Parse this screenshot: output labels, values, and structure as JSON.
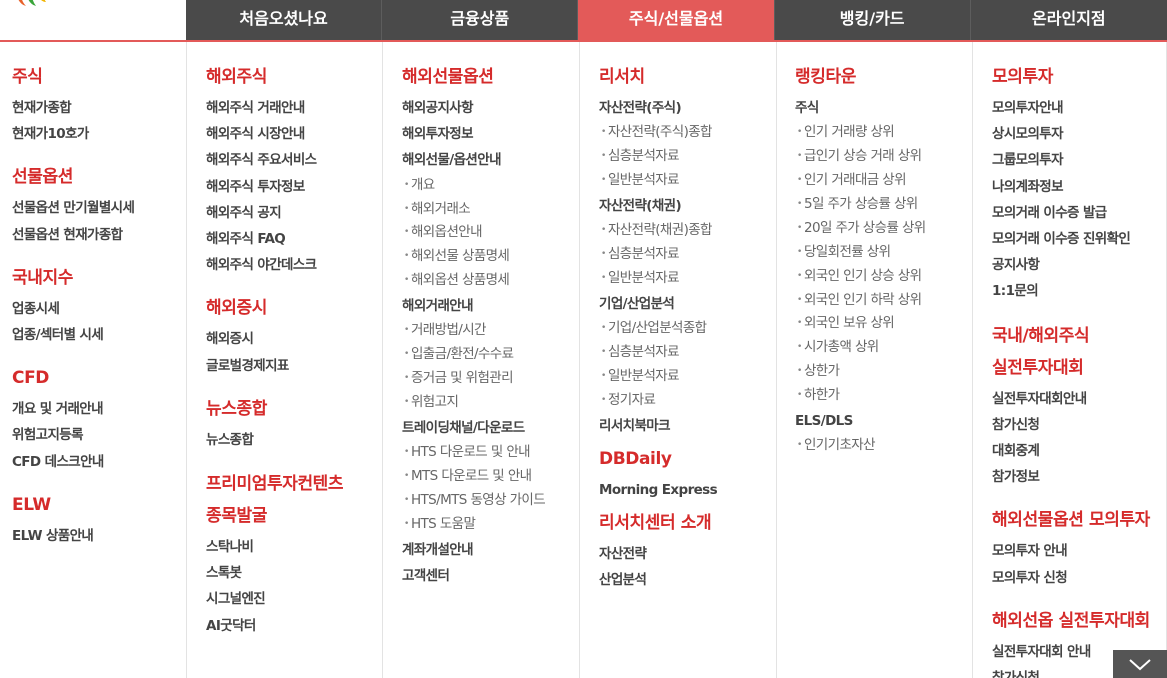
{
  "nav": {
    "items": [
      "처음오셨나요",
      "금융상품",
      "주식/선물옵션",
      "뱅킹/카드",
      "온라인지점"
    ],
    "active_index": 2
  },
  "colors": {
    "accent": "#e35a59",
    "heading": "#d52b2b",
    "nav_bg": "#4a4a4a"
  },
  "col1": {
    "sections": [
      {
        "title": "주식",
        "links": [
          "현재가종합",
          "현재가10호가"
        ]
      },
      {
        "title": "선물옵션",
        "links": [
          "선물옵션 만기월별시세",
          "선물옵션 현재가종합"
        ]
      },
      {
        "title": "국내지수",
        "links": [
          "업종시세",
          "업종/섹터별 시세"
        ]
      },
      {
        "title": "CFD",
        "links": [
          "개요 및 거래안내",
          "위험고지등록",
          "CFD 데스크안내"
        ]
      },
      {
        "title": "ELW",
        "links": [
          "ELW 상품안내"
        ]
      }
    ]
  },
  "col2": {
    "sections": [
      {
        "title": "해외주식",
        "links": [
          "해외주식 거래안내",
          "해외주식 시장안내",
          "해외주식 주요서비스",
          "해외주식 투자정보",
          "해외주식 공지",
          "해외주식 FAQ",
          "해외주식 야간데스크"
        ]
      },
      {
        "title": "해외증시",
        "links": [
          "해외증시",
          "글로벌경제지표"
        ]
      },
      {
        "title": "뉴스종합",
        "links": [
          "뉴스종합"
        ]
      },
      {
        "title_line1": "프리미엄투자컨텐츠",
        "title_line2": "종목발굴",
        "links": [
          "스탁나비",
          "스톡봇",
          "시그널엔진",
          "AI굿닥터"
        ]
      }
    ]
  },
  "col3": {
    "title": "해외선물옵션",
    "groups": [
      {
        "label": "해외공지사항",
        "subs": []
      },
      {
        "label": "해외투자정보",
        "subs": []
      },
      {
        "label": "해외선물/옵션안내",
        "subs": [
          "개요",
          "해외거래소",
          "해외옵션안내",
          "해외선물 상품명세",
          "해외옵션 상품명세"
        ]
      },
      {
        "label": "해외거래안내",
        "subs": [
          "거래방법/시간",
          "입출금/환전/수수료",
          "증거금 및 위험관리",
          "위험고지"
        ]
      },
      {
        "label": "트레이딩채널/다운로드",
        "subs": [
          "HTS 다운로드 및 안내",
          "MTS 다운로드 및 안내",
          "HTS/MTS 동영상 가이드",
          "HTS 도움말"
        ]
      },
      {
        "label": "계좌개설안내",
        "subs": []
      },
      {
        "label": "고객센터",
        "subs": []
      }
    ]
  },
  "col4": {
    "sections": [
      {
        "title": "리서치",
        "groups": [
          {
            "label": "자산전략(주식)",
            "subs": [
              "자산전략(주식)종합",
              "심층분석자료",
              "일반분석자료"
            ]
          },
          {
            "label": "자산전략(채권)",
            "subs": [
              "자산전략(채권)종합",
              "심층분석자료",
              "일반분석자료"
            ]
          },
          {
            "label": "기업/산업분석",
            "subs": [
              "기업/산업분석종합",
              "심층분석자료",
              "일반분석자료",
              "정기자료"
            ]
          },
          {
            "label": "리서치북마크",
            "subs": []
          }
        ]
      },
      {
        "title": "DBDaily",
        "groups": [
          {
            "label": "Morning Express",
            "subs": []
          }
        ]
      },
      {
        "title": "리서치센터 소개",
        "groups": [
          {
            "label": "자산전략",
            "subs": []
          },
          {
            "label": "산업분석",
            "subs": []
          }
        ]
      }
    ]
  },
  "col5": {
    "title": "랭킹타운",
    "groups": [
      {
        "label": "주식",
        "subs": [
          "인기 거래량 상위",
          "급인기 상승 거래 상위",
          "인기 거래대금 상위",
          "5일 주가 상승률 상위",
          "20일 주가 상승률 상위",
          "당일회전률 상위",
          "외국인 인기 상승 상위",
          "외국인 인기 하락 상위",
          "외국인 보유 상위",
          "시가총액 상위",
          "상한가",
          "하한가"
        ]
      },
      {
        "label": "ELS/DLS",
        "subs": [
          "인기기초자산"
        ]
      }
    ]
  },
  "col6": {
    "sections": [
      {
        "title": "모의투자",
        "links": [
          "모의투자안내",
          "상시모의투자",
          "그룹모의투자",
          "나의계좌정보",
          "모의거래 이수증 발급",
          "모의거래 이수증 진위확인",
          "공지사항",
          "1:1문의"
        ]
      },
      {
        "title_line1": "국내/해외주식",
        "title_line2": "실전투자대회",
        "links": [
          "실전투자대회안내",
          "참가신청",
          "대회중계",
          "참가정보"
        ]
      },
      {
        "title": "해외선물옵션 모의투자",
        "links": [
          "모의투자 안내",
          "모의투자 신청"
        ]
      },
      {
        "title": "해외선옵 실전투자대회",
        "links": [
          "실전투자대회 안내",
          "참가신청"
        ]
      }
    ]
  },
  "scroll_button": {
    "icon": "chevron-down-icon"
  }
}
